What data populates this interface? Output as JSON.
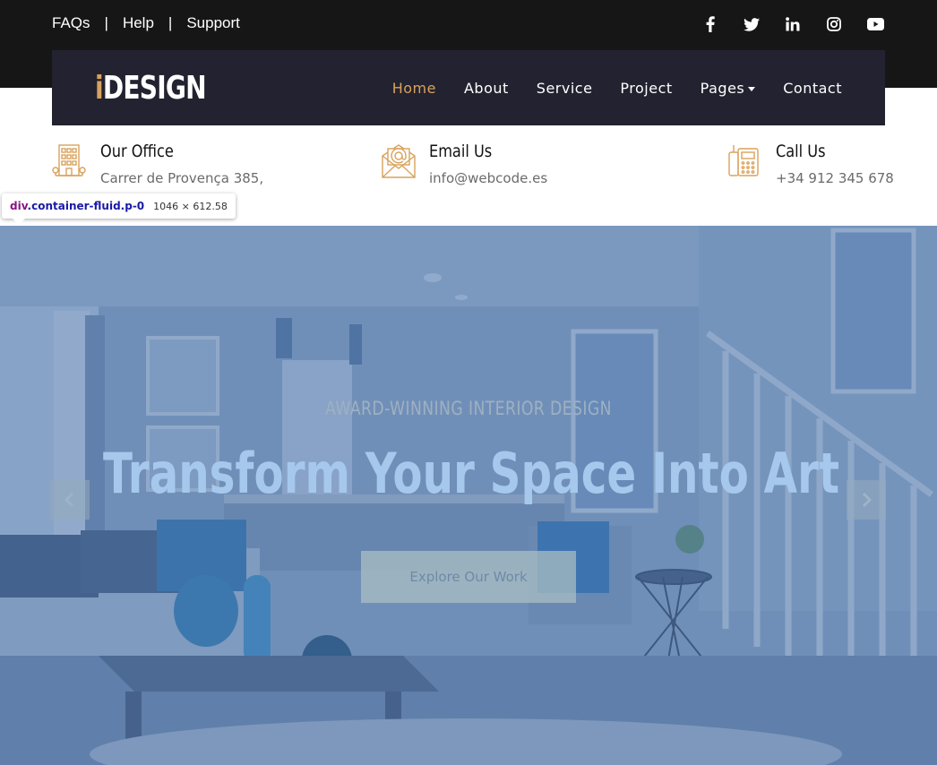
{
  "topbar": {
    "links": [
      "FAQs",
      "Help",
      "Support"
    ],
    "separator": "|",
    "socials": [
      {
        "icon": "facebook-icon"
      },
      {
        "icon": "twitter-icon"
      },
      {
        "icon": "linkedin-icon"
      },
      {
        "icon": "instagram-icon"
      },
      {
        "icon": "youtube-icon"
      }
    ]
  },
  "navbar": {
    "logo_first": "i",
    "logo_rest": "DESIGN",
    "items": [
      {
        "label": "Home",
        "active": true
      },
      {
        "label": "About"
      },
      {
        "label": "Service"
      },
      {
        "label": "Project"
      },
      {
        "label": "Pages",
        "dropdown": true
      },
      {
        "label": "Contact"
      }
    ]
  },
  "contact_info": [
    {
      "icon": "building-icon",
      "title": "Our Office",
      "text": "Carrer de Provença 385,"
    },
    {
      "icon": "envelope-icon",
      "title": "Email Us",
      "text": "info@webcode.es"
    },
    {
      "icon": "phone-icon",
      "title": "Call Us",
      "text": "+34 912 345 678"
    }
  ],
  "inspector_tooltip": {
    "tag": "div",
    "classes": ".container-fluid.p-0",
    "size": "1046 × 612.58"
  },
  "hero": {
    "subtitle": "AWARD-WINNING INTERIOR DESIGN",
    "title": "Transform Your Space Into Art",
    "button_label": "Explore Our Work"
  },
  "colors": {
    "accent": "#d9a25c",
    "navbar_bg": "#232230",
    "topbar_bg": "#161616"
  }
}
